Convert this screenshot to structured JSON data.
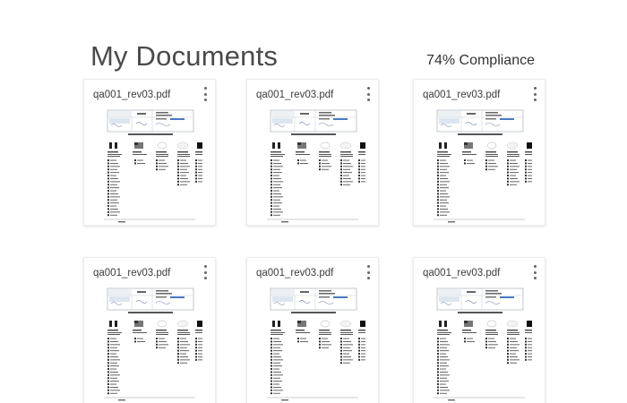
{
  "page": {
    "title": "My Documents",
    "compliance": "74% Compliance"
  },
  "documents": [
    {
      "name": "qa001_rev03.pdf"
    },
    {
      "name": "qa001_rev03.pdf"
    },
    {
      "name": "qa001_rev03.pdf"
    },
    {
      "name": "qa001_rev03.pdf"
    },
    {
      "name": "qa001_rev03.pdf"
    },
    {
      "name": "qa001_rev03.pdf"
    }
  ],
  "icons": {
    "more": "more-vertical-icon"
  }
}
